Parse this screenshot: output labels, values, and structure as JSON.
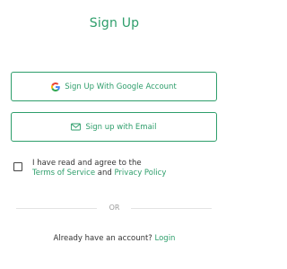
{
  "title": "Sign Up",
  "buttons": {
    "google_label": "Sign Up With Google Account",
    "email_label": "Sign up with Email"
  },
  "agreement": {
    "line1": "I have read and agree to the",
    "terms": "Terms of Service",
    "and": "and",
    "privacy": "Privacy Policy",
    "checked": false
  },
  "divider_text": "OR",
  "footer": {
    "prompt": "Already have an account?",
    "login": "Login"
  },
  "colors": {
    "accent": "#2e9e6b",
    "text": "#333333",
    "muted": "#9a9a9a",
    "divider": "#e3e3e3"
  },
  "icons": {
    "google": "google-icon",
    "email": "envelope-icon"
  }
}
